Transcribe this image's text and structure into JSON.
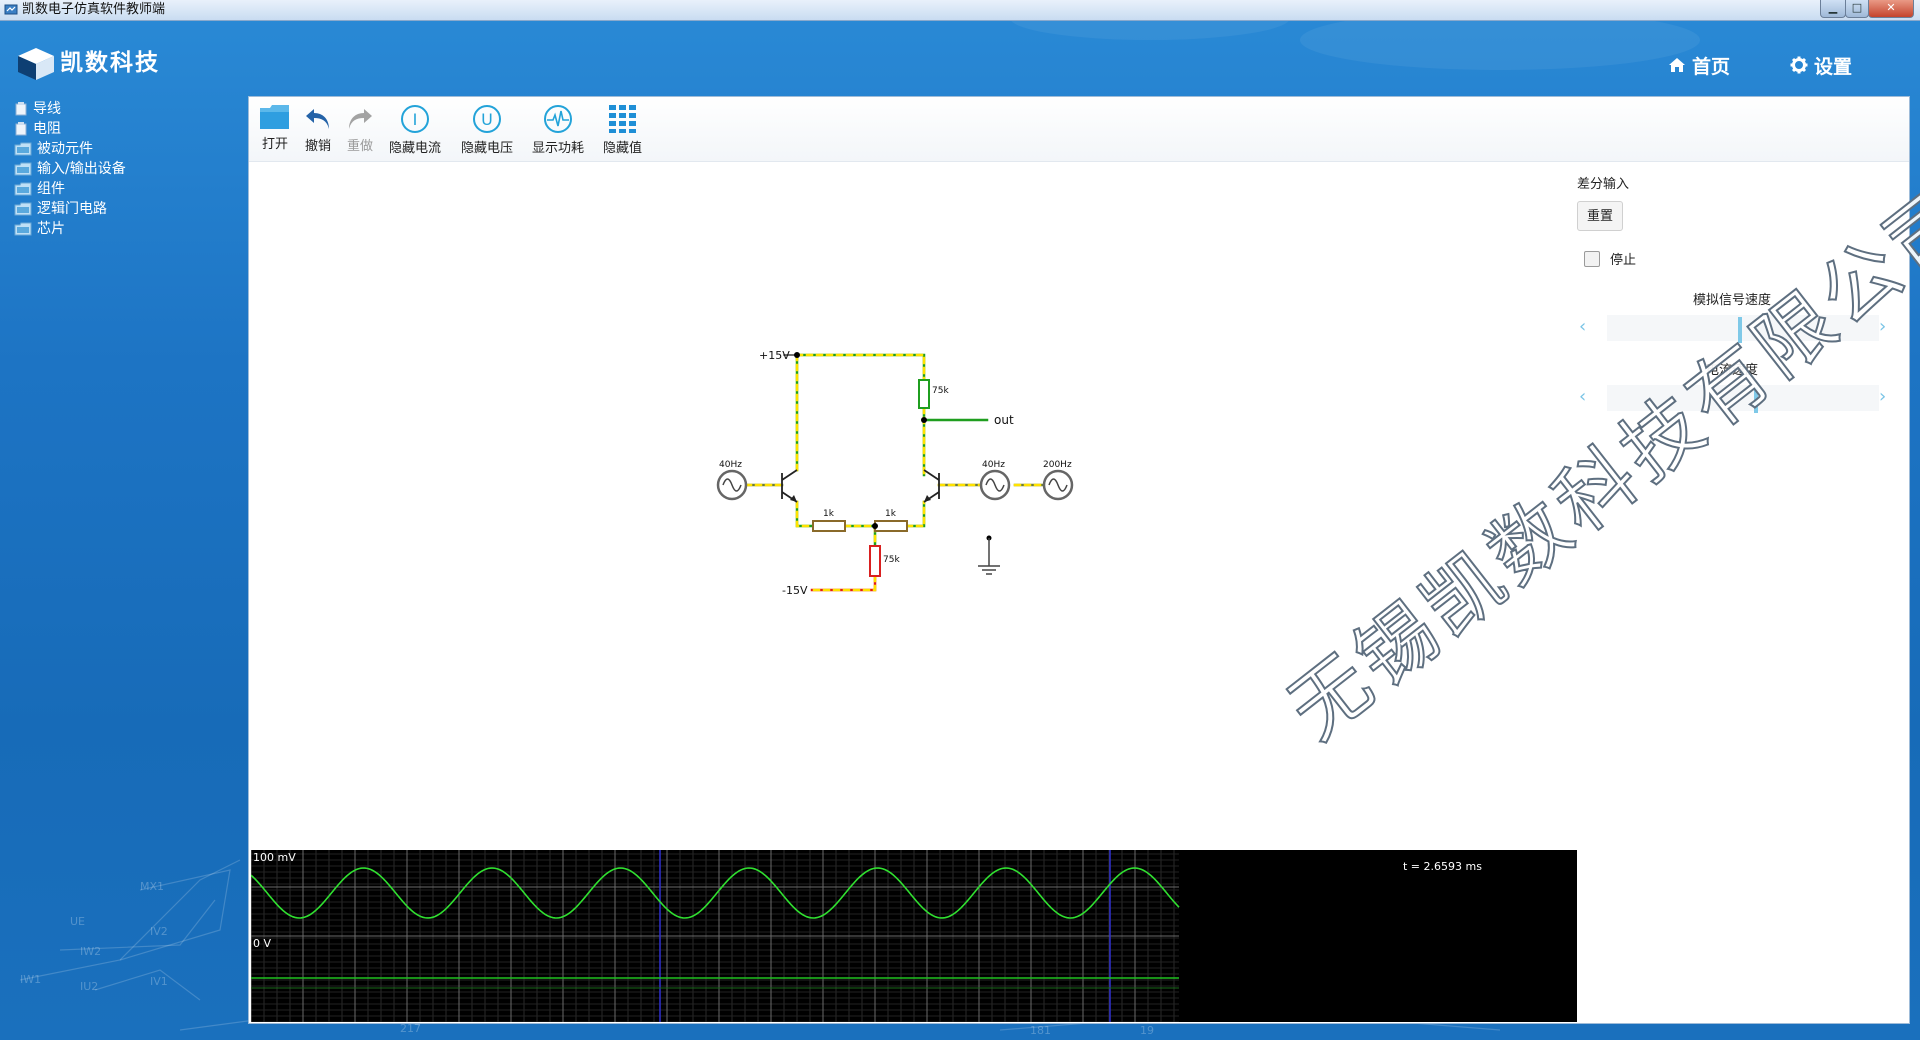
{
  "window": {
    "title": "凯数电子仿真软件教师端"
  },
  "window_controls": {
    "minimize": "▁",
    "maximize": "□",
    "close": "✕"
  },
  "brand": {
    "name": "凯数科技"
  },
  "nav": {
    "home": "首页",
    "settings": "设置"
  },
  "tree": [
    {
      "label": "导线",
      "icon": "component-icon"
    },
    {
      "label": "电阻",
      "icon": "component-icon"
    },
    {
      "label": "被动元件",
      "icon": "folder-icon"
    },
    {
      "label": "输入/输出设备",
      "icon": "folder-icon"
    },
    {
      "label": "组件",
      "icon": "folder-icon"
    },
    {
      "label": "逻辑门电路",
      "icon": "folder-icon"
    },
    {
      "label": "芯片",
      "icon": "folder-icon"
    }
  ],
  "toolbar": {
    "open": "打开",
    "undo": "撤销",
    "redo": "重做",
    "hide_current": "隐藏电流",
    "hide_voltage": "隐藏电压",
    "show_power": "显示功耗",
    "hide_values": "隐藏值"
  },
  "circuit": {
    "vcc_label": "+15V",
    "vee_label": "-15V",
    "r_collector": "75k",
    "r_tail": "75k",
    "r_emitter_left": "1k",
    "r_emitter_right": "1k",
    "out_label": "out",
    "src_left": "40Hz",
    "src_right": "40Hz",
    "src_far": "200Hz"
  },
  "right_panel": {
    "title": "差分输入",
    "reset": "重置",
    "stop": "停止",
    "stop_checked": false,
    "sim_speed_label": "模拟信号速度",
    "sim_speed_value": 0.49,
    "current_speed_label": "电流速度",
    "current_speed_value": 0.55
  },
  "scope": {
    "top_label": "100 mV",
    "zero_label": "0 V",
    "time_label": "t = 2.6593 ms"
  },
  "watermark": "无锡凯数科技有限公司"
}
